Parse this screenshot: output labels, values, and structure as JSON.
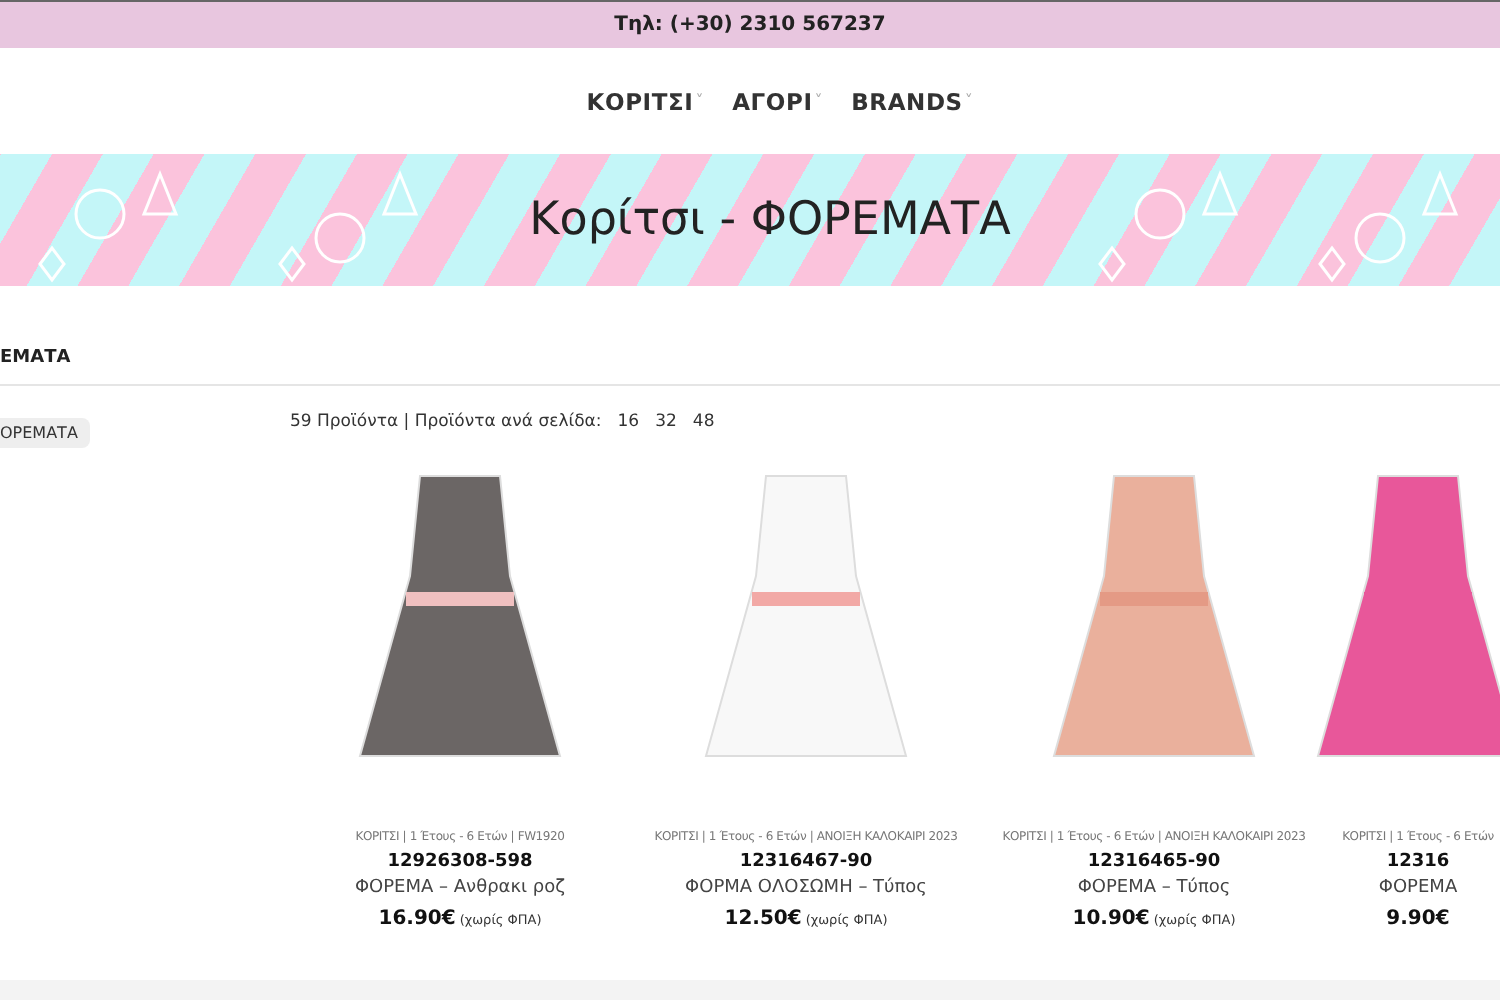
{
  "top_bar": {
    "phone": "Τηλ: (+30) 2310 567237"
  },
  "nav": {
    "items": [
      {
        "label": "ΚΟΡΙΤΣΙ",
        "caret": "˅"
      },
      {
        "label": "ΑΓΟΡΙ",
        "caret": "˅"
      },
      {
        "label": "BRANDS",
        "caret": "˅"
      }
    ]
  },
  "banner": {
    "title": "Κορίτσι - ΦΟΡΕΜΑΤΑ"
  },
  "breadcrumb": "ΕΜΑΤΑ",
  "sidebar": {
    "filter_tag": "ΟΡΕΜΑΤΑ"
  },
  "toolbar": {
    "count": "59 Προϊόντα | Προϊόντα ανά σελίδα:",
    "per_page": [
      {
        "label": "16",
        "selected": false
      },
      {
        "label": "32",
        "selected": false
      },
      {
        "label": "48",
        "selected": false
      }
    ]
  },
  "products": [
    {
      "meta": "ΚΟΡΙΤΣΙ | 1 Έτους - 6 Ετών | FW1920",
      "code": "12926308-598",
      "name": "ΦΟΡΕΜΑ – Ανθρακι ροζ",
      "price": "16.90€",
      "tax_note": "(χωρίς ΦΠΑ)"
    },
    {
      "meta": "ΚΟΡΙΤΣΙ | 1 Έτους - 6 Ετών | ΑΝΟΙΞΗ ΚΑΛΟΚΑΙΡΙ 2023",
      "code": "12316467-90",
      "name": "ΦΟΡΜΑ ΟΛΟΣΩΜΗ – Τύπος",
      "price": "12.50€",
      "tax_note": "(χωρίς ΦΠΑ)"
    },
    {
      "meta": "ΚΟΡΙΤΣΙ | 1 Έτους - 6 Ετών | ΑΝΟΙΞΗ ΚΑΛΟΚΑΙΡΙ 2023",
      "code": "12316465-90",
      "name": "ΦΟΡΕΜΑ – Τύπος",
      "price": "10.90€",
      "tax_note": "(χωρίς ΦΠΑ)"
    },
    {
      "meta": "ΚΟΡΙΤΣΙ | 1 Έτους - 6 Ετών",
      "code": "12316",
      "name": "ΦΟΡΕΜΑ",
      "price": "9.90€"
    }
  ]
}
